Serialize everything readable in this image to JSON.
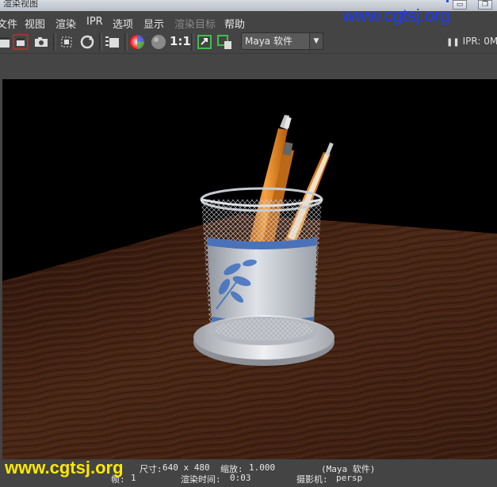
{
  "window": {
    "title": "渲染视图",
    "minimize_glyph": "▭",
    "restore_glyph": "❐"
  },
  "watermark": {
    "top": "www.cgtsj.org",
    "bottom": "www.cgtsj.org"
  },
  "menu": {
    "items": [
      {
        "label": "文件"
      },
      {
        "label": "视图"
      },
      {
        "label": "渲染"
      },
      {
        "label": "IPR"
      },
      {
        "label": "选项"
      },
      {
        "label": "显示"
      },
      {
        "label": "渲染目标"
      },
      {
        "label": "帮助"
      }
    ]
  },
  "toolbar": {
    "ratio_label": "1:1",
    "renderer": "Maya 软件",
    "ipr_status": "IPR: 0M",
    "pause_glyph": "❚❚",
    "icons": [
      "clapper-icon",
      "clapper-selected-icon",
      "camera-snapshot-icon",
      "clapper-region-icon",
      "refresh-icon",
      "clapper-settings-icon",
      "color-wheel-icon",
      "gray-ball-icon",
      "real-size-icon",
      "keep-image-icon",
      "remove-image-icon",
      "dropdown-arrow-icon",
      "pause-icon"
    ]
  },
  "status": {
    "size_label": "尺寸:",
    "size_value": "640 x 480",
    "zoom_label": "缩放:",
    "zoom_value": "1.000",
    "renderer": "(Maya 软件)",
    "frame_label": "帧:",
    "frame_value": "1",
    "time_label": "渲染时间:",
    "time_value": "0:03",
    "camera_label": "摄影机:",
    "camera_value": "persp"
  },
  "colors": {
    "background": "#444444",
    "viewport": "#000000",
    "watermark_top": "#1a3cff",
    "watermark_bottom": "#ffe800"
  }
}
